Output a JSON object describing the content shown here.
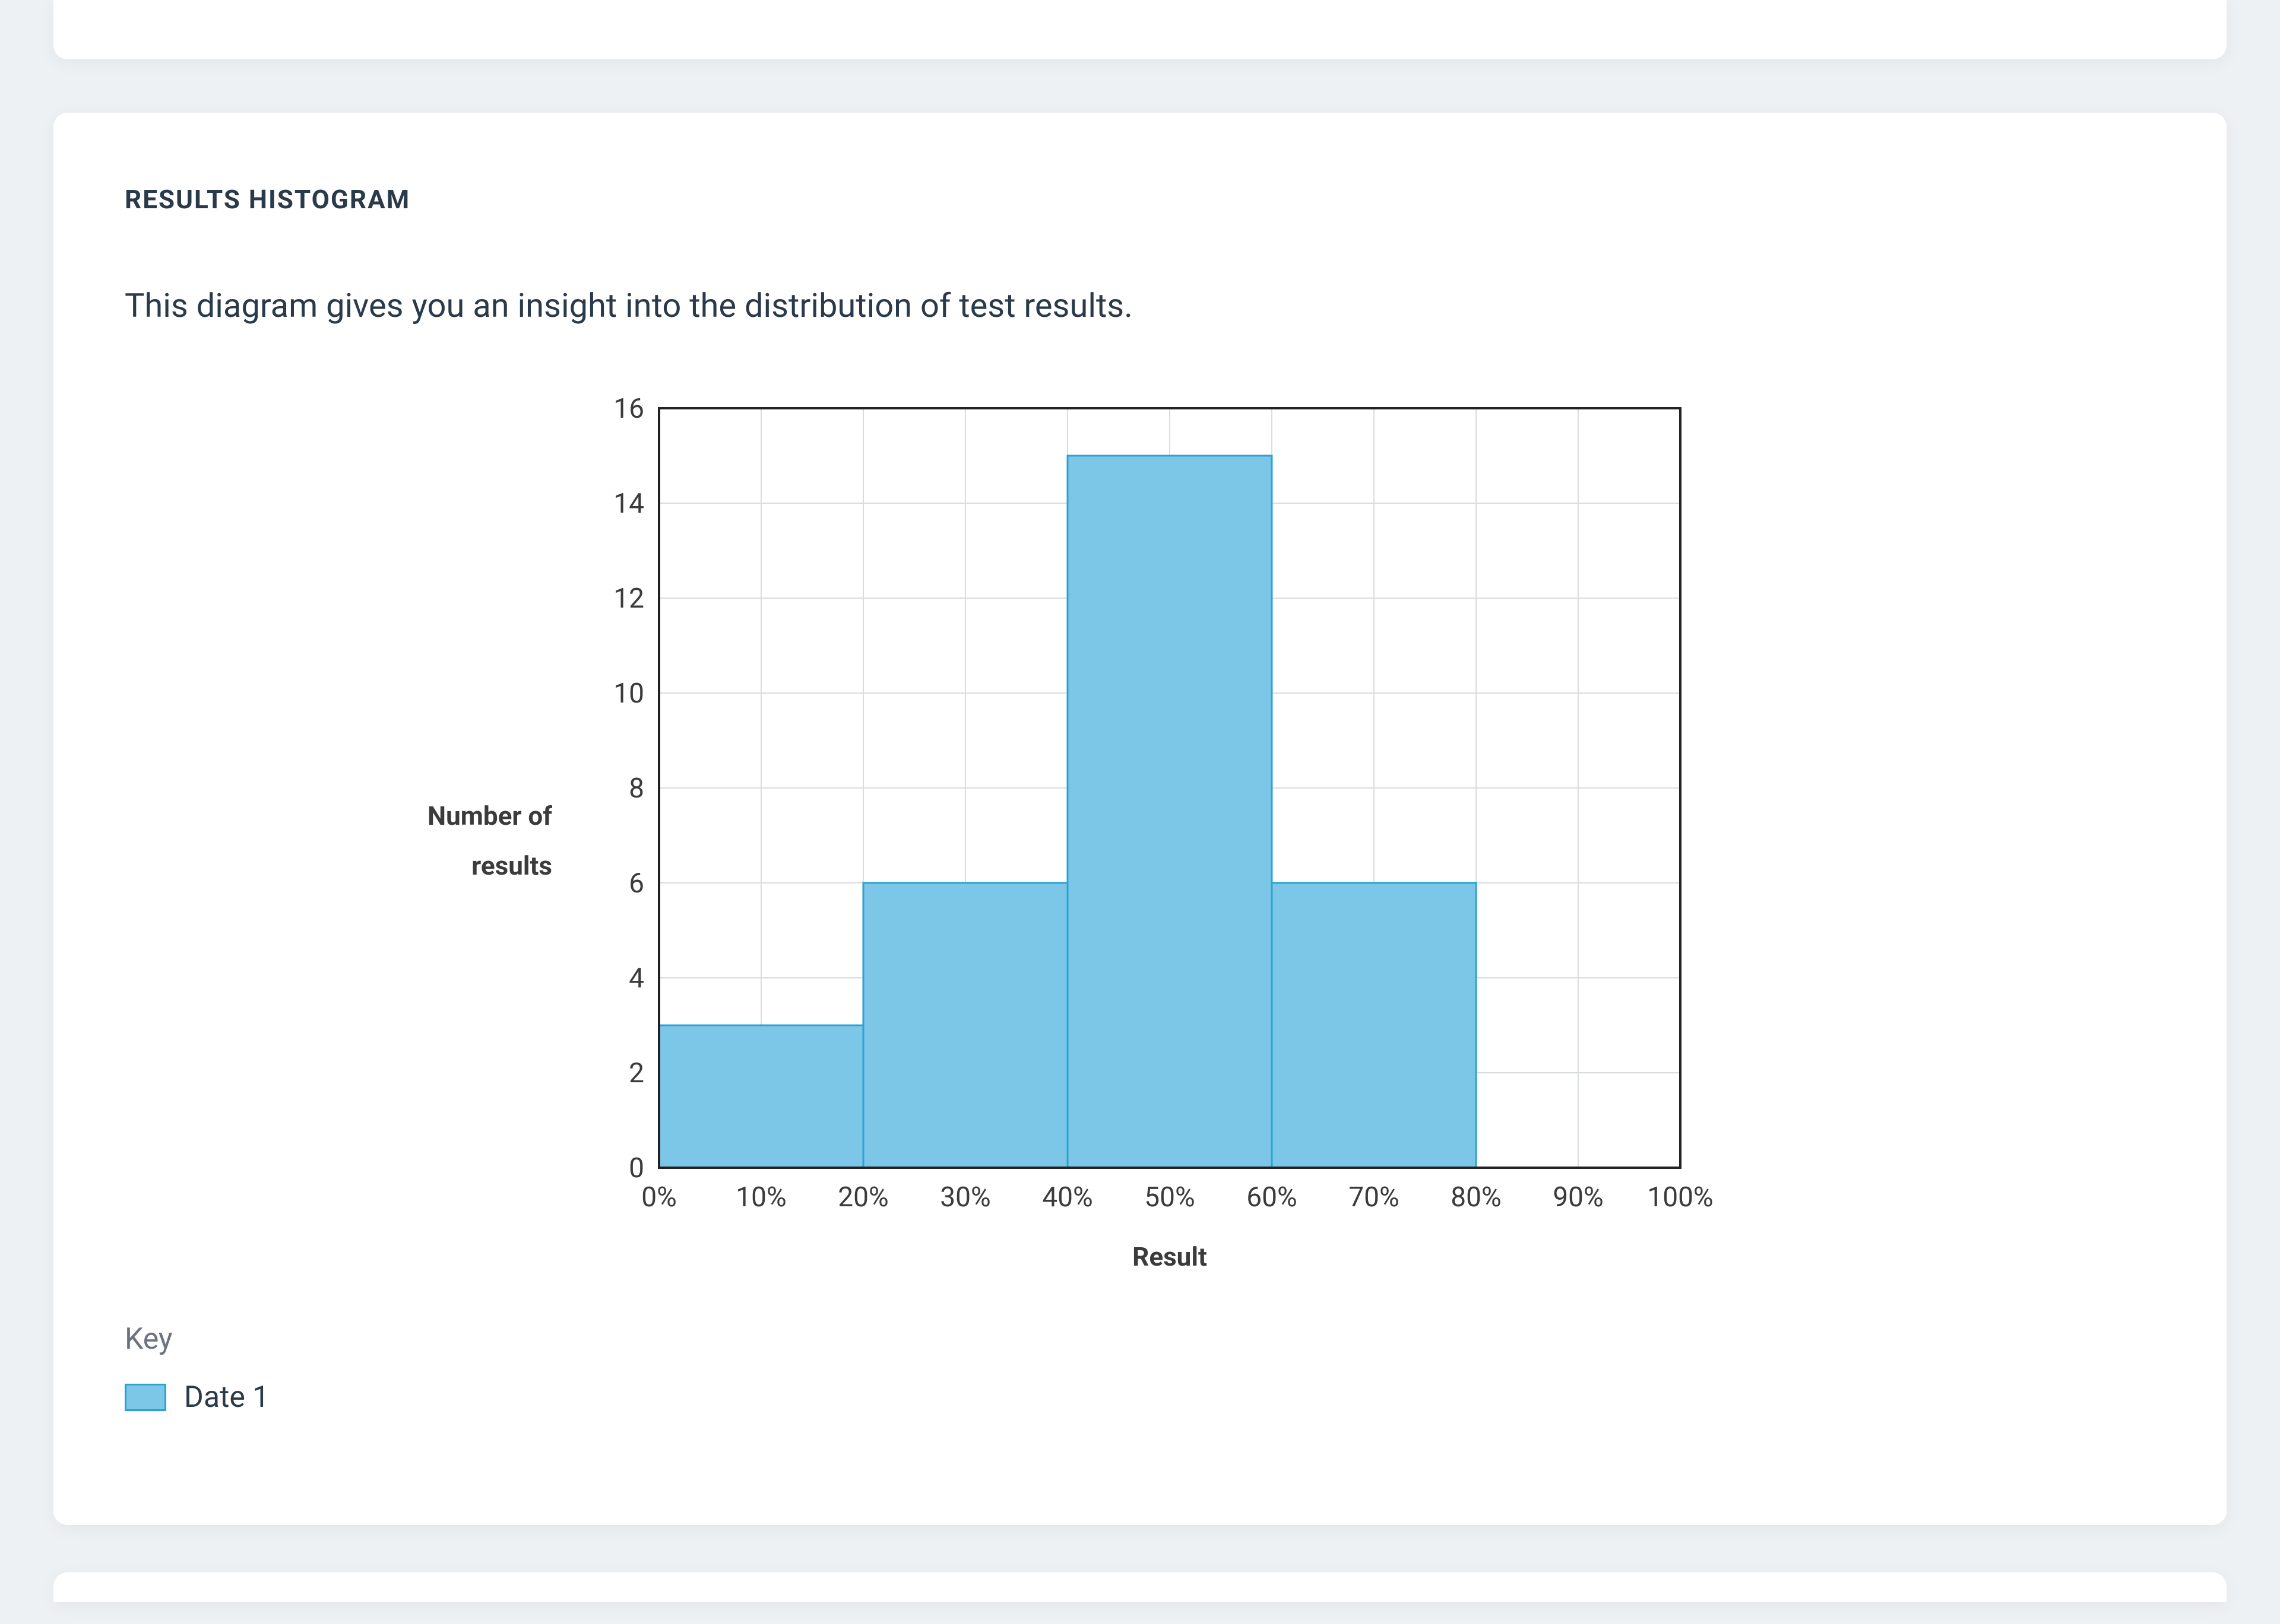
{
  "section": {
    "title": "RESULTS HISTOGRAM",
    "description": "This diagram gives you an insight into the distribution of test results."
  },
  "legend": {
    "title": "Key",
    "items": [
      {
        "label": "Date 1",
        "color": "#7cc7e8"
      }
    ]
  },
  "chart_data": {
    "type": "bar",
    "title": "",
    "xlabel": "Result",
    "ylabel": "Number of results",
    "x_ticks": [
      "0%",
      "10%",
      "20%",
      "30%",
      "40%",
      "50%",
      "60%",
      "70%",
      "80%",
      "90%",
      "100%"
    ],
    "y_ticks": [
      0,
      2,
      4,
      6,
      8,
      10,
      12,
      14,
      16
    ],
    "ylim": [
      0,
      16
    ],
    "bin_edges_pct": [
      0,
      20,
      40,
      60,
      80,
      100
    ],
    "series": [
      {
        "name": "Date 1",
        "values": [
          3,
          6,
          15,
          6,
          0
        ]
      }
    ]
  }
}
